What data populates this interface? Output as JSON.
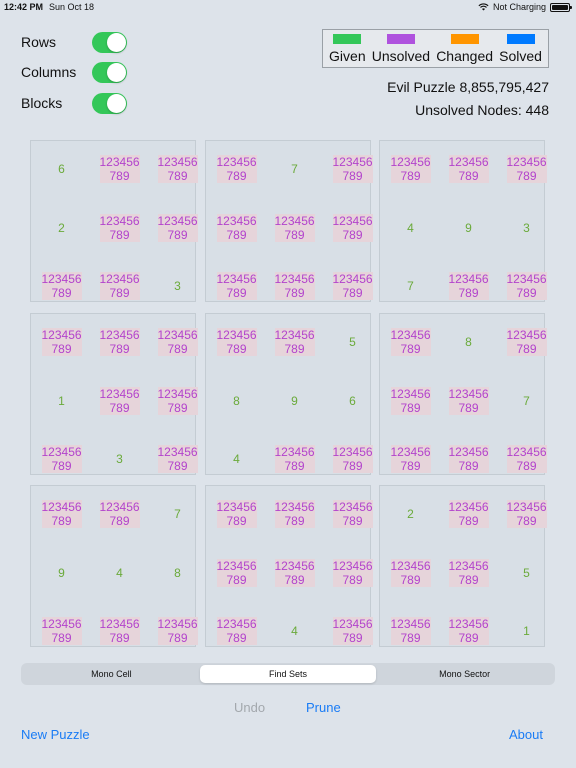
{
  "status": {
    "time": "12:42 PM",
    "date": "Sun Oct 18",
    "battery": "Not Charging"
  },
  "toggles": [
    {
      "label": "Rows",
      "on": true
    },
    {
      "label": "Columns",
      "on": true
    },
    {
      "label": "Blocks",
      "on": true
    }
  ],
  "legend": [
    {
      "label": "Given",
      "color": "#34c759"
    },
    {
      "label": "Unsolved",
      "color": "#af52de"
    },
    {
      "label": "Changed",
      "color": "#ff9500"
    },
    {
      "label": "Solved",
      "color": "#007aff"
    }
  ],
  "puzzle_title": "Evil Puzzle 8,855,795,427",
  "unsolved_nodes": "Unsolved Nodes: 448",
  "candidates_line1": "123456",
  "candidates_line2": "789",
  "board": [
    [
      6,
      0,
      0,
      0,
      7,
      0,
      0,
      0,
      0
    ],
    [
      2,
      0,
      0,
      0,
      0,
      0,
      4,
      9,
      3
    ],
    [
      0,
      0,
      3,
      0,
      0,
      0,
      7,
      0,
      0
    ],
    [
      0,
      0,
      0,
      0,
      0,
      5,
      0,
      8,
      0
    ],
    [
      1,
      0,
      0,
      8,
      9,
      6,
      0,
      0,
      7
    ],
    [
      0,
      3,
      0,
      4,
      0,
      0,
      0,
      0,
      0
    ],
    [
      0,
      0,
      7,
      0,
      0,
      0,
      2,
      0,
      0
    ],
    [
      9,
      4,
      8,
      0,
      0,
      0,
      0,
      0,
      5
    ],
    [
      0,
      0,
      0,
      0,
      4,
      0,
      0,
      0,
      1
    ]
  ],
  "segments": [
    {
      "label": "Mono Cell",
      "active": false
    },
    {
      "label": "Find Sets",
      "active": true
    },
    {
      "label": "Mono Sector",
      "active": false
    }
  ],
  "buttons": {
    "undo": "Undo",
    "prune": "Prune",
    "new_puzzle": "New Puzzle",
    "about": "About"
  }
}
